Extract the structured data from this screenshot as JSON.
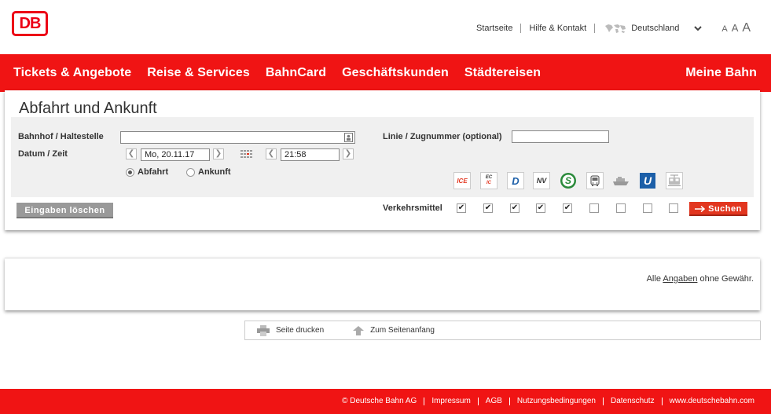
{
  "brand": {
    "logo_text": "DB",
    "accent": "#f01414",
    "logo_color": "#ec0016"
  },
  "topnav": {
    "links": [
      "Startseite",
      "Hilfe & Kontakt"
    ],
    "country": "Deutschland",
    "font_sizes": [
      "A",
      "A",
      "A"
    ]
  },
  "mainnav": {
    "items": [
      "Tickets & Angebote",
      "Reise & Services",
      "BahnCard",
      "Geschäftskunden",
      "Städtereisen"
    ],
    "right": "Meine Bahn"
  },
  "form": {
    "title": "Abfahrt und Ankunft",
    "station_label": "Bahnhof / Haltestelle",
    "station_value": "",
    "datetime_label": "Datum / Zeit",
    "date_value": "Mo, 20.11.17",
    "time_value": "21:58",
    "radio_departure": "Abfahrt",
    "radio_arrival": "Ankunft",
    "line_label": "Linie / Zugnummer (optional)",
    "line_value": "",
    "transport_label": "Verkehrsmittel",
    "modes": [
      {
        "icon": "ice-icon",
        "label": "ICE",
        "checked": true
      },
      {
        "icon": "ec-ic-icon",
        "label": "EC IC",
        "checked": true
      },
      {
        "icon": "d-train-icon",
        "label": "D",
        "checked": true
      },
      {
        "icon": "nv-icon",
        "label": "NV",
        "checked": true
      },
      {
        "icon": "s-bahn-icon",
        "label": "S",
        "checked": true
      },
      {
        "icon": "bus-icon",
        "label": "",
        "checked": false
      },
      {
        "icon": "ferry-icon",
        "label": "",
        "checked": false
      },
      {
        "icon": "u-bahn-icon",
        "label": "U",
        "checked": false
      },
      {
        "icon": "tram-icon",
        "label": "",
        "checked": false
      }
    ],
    "clear_label": "Eingaben löschen",
    "search_label": "Suchen"
  },
  "note": {
    "prefix": "Alle ",
    "link": "Angaben",
    "suffix": " ohne Gewähr."
  },
  "printbar": {
    "print": "Seite drucken",
    "top": "Zum Seitenanfang"
  },
  "footer": {
    "links": [
      "© Deutsche Bahn AG",
      "Impressum",
      "AGB",
      "Nutzungsbedingungen",
      "Datenschutz",
      "www.deutschebahn.com"
    ]
  }
}
